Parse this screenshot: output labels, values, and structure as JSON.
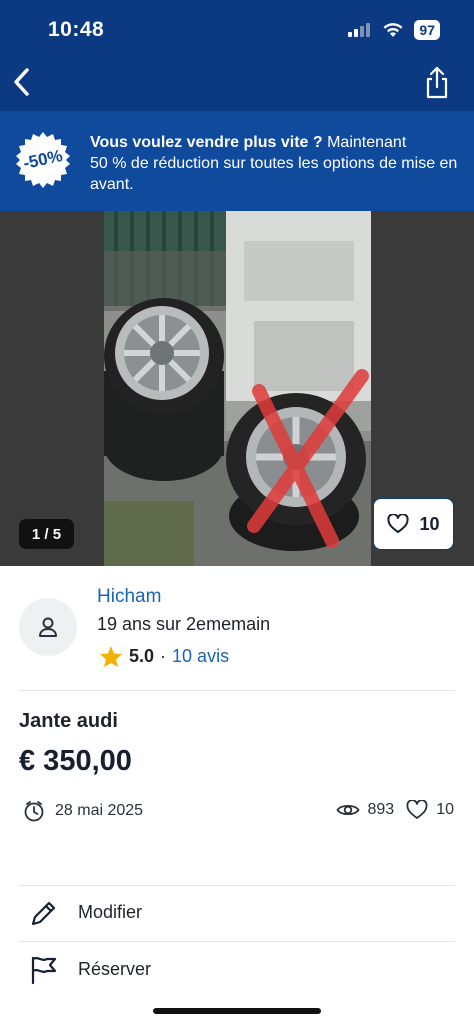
{
  "status_bar": {
    "time": "10:48",
    "battery": "97"
  },
  "nav": {
    "back_icon": "chevron-left-icon",
    "share_icon": "share-icon"
  },
  "promo": {
    "badge": "-50%",
    "headline": "Vous voulez vendre plus vite ?",
    "text_line1": " Maintenant",
    "text_line2": "50 % de réduction sur toutes les options de mise en avant."
  },
  "gallery": {
    "counter": "1 / 5",
    "favorites": "10"
  },
  "seller": {
    "name": "Hicham",
    "since": "19 ans sur 2ememain",
    "rating": "5.0",
    "separator": "·",
    "reviews": "10 avis"
  },
  "listing": {
    "title": "Jante audi",
    "price": "€ 350,00",
    "date": "28 mai 2025",
    "views": "893",
    "likes": "10"
  },
  "actions": [
    {
      "label": "Modifier",
      "icon": "pencil-icon"
    },
    {
      "label": "Réserver",
      "icon": "flag-icon"
    }
  ],
  "colors": {
    "primary": "#0b3a82",
    "promo": "#0f4a9d",
    "link": "#1b63b5",
    "star": "#f2b100"
  }
}
